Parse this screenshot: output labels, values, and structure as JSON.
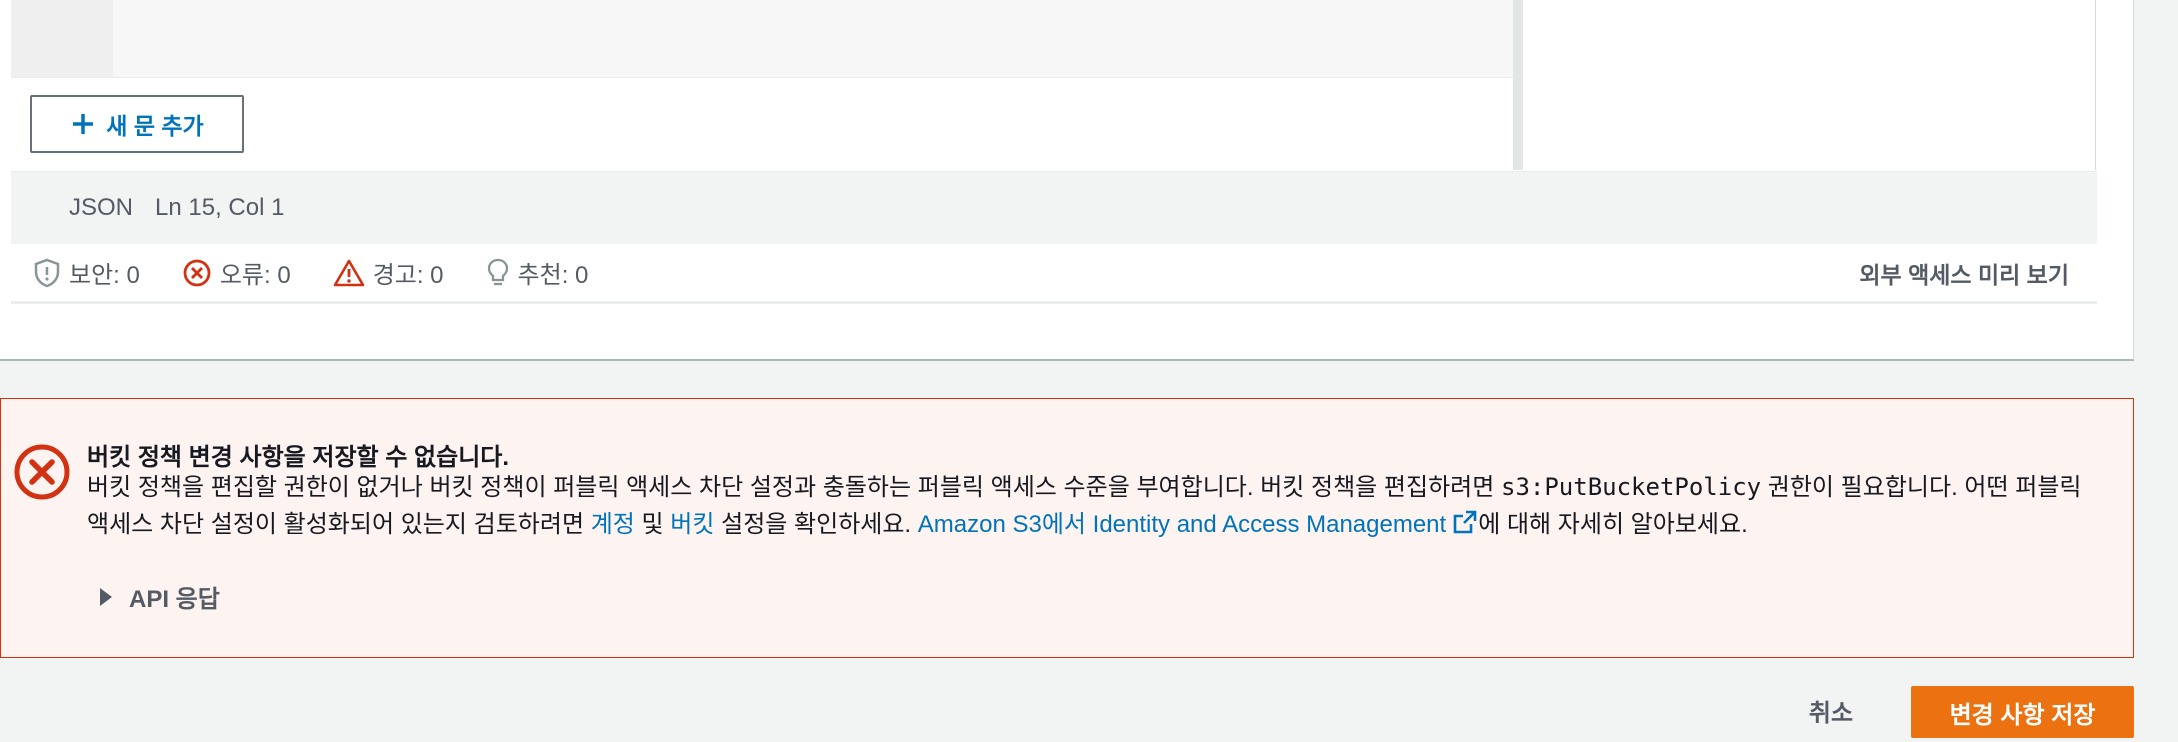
{
  "editor": {
    "add_statement_label": "새 문 추가",
    "status": {
      "language": "JSON",
      "position": "Ln 15, Col 1"
    },
    "diagnostics": {
      "security": "보안: 0",
      "errors": "오류: 0",
      "warnings": "경고: 0",
      "suggestions": "추천: 0"
    },
    "preview_external_access": "외부 액세스 미리 보기"
  },
  "alert": {
    "title": "버킷 정책 변경 사항을 저장할 수 없습니다.",
    "body_1": "버킷 정책을 편집할 권한이 없거나 버킷 정책이 퍼블릭 액세스 차단 설정과 충돌하는 퍼블릭 액세스 수준을 부여합니다. 버킷 정책을 편집하려면 ",
    "permission_code": "s3:PutBucketPolicy",
    "body_2": " 권한이 필요합니다. 어떤 퍼블릭 액세스 차단 설정이 활성화되어 있는지 검토하려면 ",
    "link_account": "계정",
    "body_3": " 및 ",
    "link_bucket": "버킷",
    "body_4": " 설정을 확인하세요. ",
    "link_iam": "Amazon S3에서 Identity and Access Management",
    "body_5": "에 대해 자세히 알아보세요.",
    "api_response_label": "API 응답"
  },
  "footer": {
    "cancel_label": "취소",
    "save_label": "변경 사항 저장"
  },
  "colors": {
    "accent_link": "#0073bb",
    "error": "#d13212",
    "primary_button": "#ec7211"
  },
  "icons": [
    "plus-icon",
    "shield-icon",
    "error-circle-icon",
    "warning-icon",
    "lightbulb-icon",
    "external-link-icon",
    "caret-right-icon"
  ]
}
